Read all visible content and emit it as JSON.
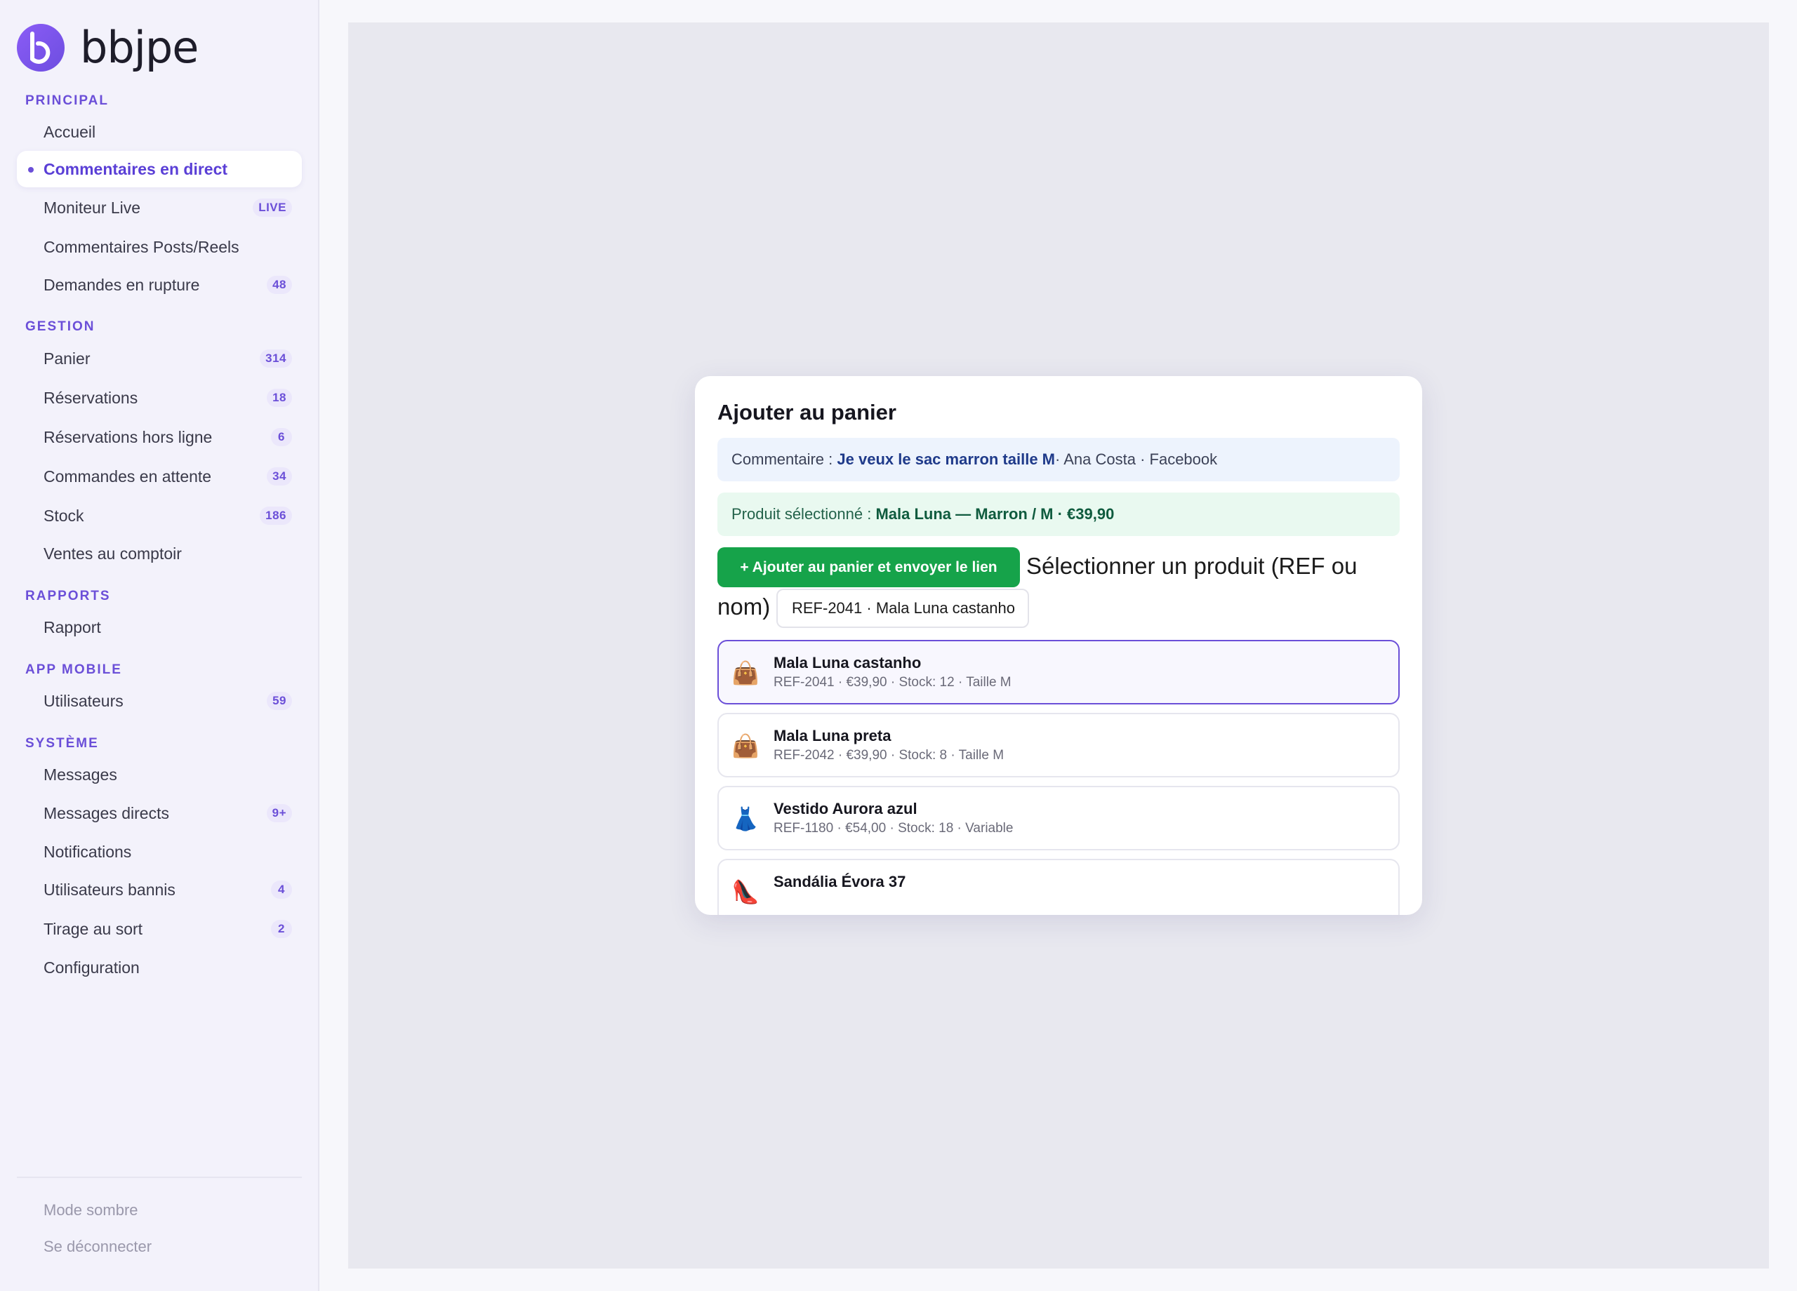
{
  "brand": {
    "name": "bbjpe"
  },
  "sidebar": {
    "sections": [
      {
        "title": "PRINCIPAL"
      },
      {
        "title": "GESTION"
      },
      {
        "title": "RAPPORTS"
      },
      {
        "title": "APP MOBILE"
      },
      {
        "title": "SYSTÈME"
      }
    ],
    "items": [
      {
        "label": "Accueil"
      },
      {
        "label": "Commentaires en direct",
        "active": true
      },
      {
        "label": "Moniteur Live",
        "badge": "LIVE"
      },
      {
        "label": "Commentaires Posts/Reels"
      },
      {
        "label": "Demandes en rupture",
        "badge": "48"
      },
      {
        "label": "Panier",
        "badge": "314"
      },
      {
        "label": "Réservations",
        "badge": "18"
      },
      {
        "label": "Réservations hors ligne",
        "badge": "6"
      },
      {
        "label": "Commandes en attente",
        "badge": "34"
      },
      {
        "label": "Stock",
        "badge": "186"
      },
      {
        "label": "Ventes au comptoir"
      },
      {
        "label": "Rapport"
      },
      {
        "label": "Utilisateurs",
        "badge": "59"
      },
      {
        "label": "Messages"
      },
      {
        "label": "Messages directs",
        "badge": "9+"
      },
      {
        "label": "Notifications"
      },
      {
        "label": "Utilisateurs bannis",
        "badge": "4"
      },
      {
        "label": "Tirage au sort",
        "badge": "2"
      },
      {
        "label": "Configuration"
      }
    ],
    "footer": {
      "dark_mode": "Mode sombre",
      "logout": "Se déconnecter"
    }
  },
  "modal": {
    "title": "Ajouter au panier",
    "comment": {
      "prefix": "Commentaire : ",
      "text": "Je veux le sac marron taille M",
      "suffix": " · Ana Costa · Facebook"
    },
    "selected_product": {
      "prefix": "Produit sélectionné : ",
      "text": "Mala Luna — Marron / M · €39,90"
    },
    "add_button": "+ Ajouter au panier et envoyer le lien",
    "select_label_1": "Sélectionner un produit (REF ou",
    "select_label_2": "nom)",
    "search_value": "REF-2041 · Mala Luna castanho",
    "results": [
      {
        "icon": "handbag-icon",
        "emoji": "👜",
        "name": "Mala Luna castanho",
        "meta": "REF-2041 · €39,90 · Stock: 12 · Taille M",
        "selected": true
      },
      {
        "icon": "handbag-icon",
        "emoji": "👜",
        "name": "Mala Luna preta",
        "meta": "REF-2042 · €39,90 · Stock: 8 · Taille M"
      },
      {
        "icon": "dress-icon",
        "emoji": "👗",
        "name": "Vestido Aurora azul",
        "meta": "REF-1180 · €54,00 · Stock: 18 · Variable"
      },
      {
        "icon": "high-heel-icon",
        "emoji": "👠",
        "name": "Sandália Évora 37",
        "meta": ""
      }
    ]
  },
  "colors": {
    "accent": "#6b4fd8",
    "primary_button": "#16a34a"
  }
}
